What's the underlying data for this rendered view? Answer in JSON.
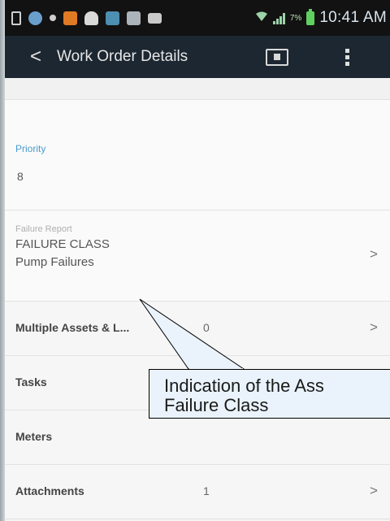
{
  "status_bar": {
    "time": "10:41 AM",
    "network_label": "7%",
    "icons": [
      "usb-icon",
      "notification-icon",
      "dot-icon",
      "image-icon",
      "cloud-icon",
      "photo-icon",
      "doc-icon",
      "email-icon",
      "wifi-icon",
      "signal-icon",
      "battery-icon"
    ],
    "colors": {
      "background": "#121212",
      "battery": "#5fd05f"
    }
  },
  "action_bar": {
    "back_symbol": "<",
    "title": "Work Order Details",
    "icons": [
      "card-view-icon",
      "overflow-menu-icon"
    ],
    "background": "#1c2731"
  },
  "priority": {
    "label": "Priority",
    "value": "8",
    "label_color": "#4a9bd1"
  },
  "failure_report": {
    "label": "Failure Report",
    "class_label": "FAILURE CLASS",
    "class_value": "Pump Failures",
    "chevron": ">"
  },
  "rows": [
    {
      "label": "Multiple Assets & L...",
      "count": "0",
      "chevron": ">"
    },
    {
      "label": "Tasks",
      "count": "",
      "chevron": ""
    },
    {
      "label": "Meters",
      "count": "",
      "chevron": ""
    },
    {
      "label": "Attachments",
      "count": "1",
      "chevron": ">"
    }
  ],
  "callout": {
    "line1": "Indication of the Ass",
    "line2": "Failure Class"
  }
}
